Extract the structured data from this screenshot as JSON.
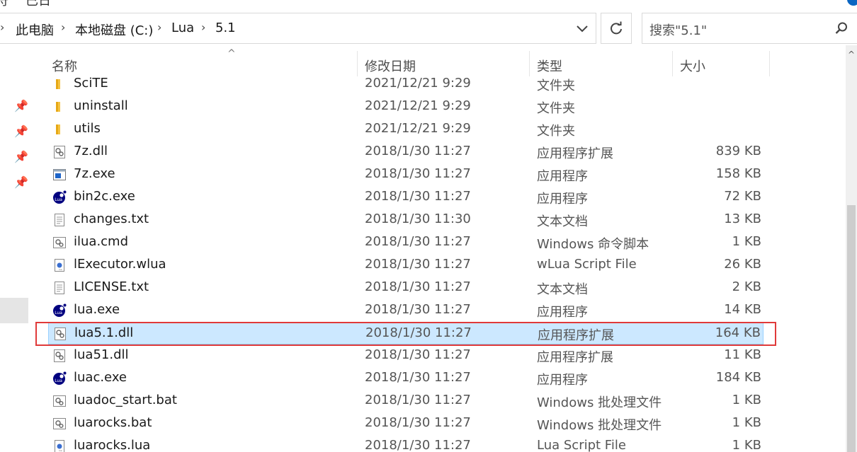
{
  "top": {
    "fragment_left": "符",
    "fragment_mid": "已日"
  },
  "address_bar": {
    "crumbs": [
      "此电脑",
      "本地磁盘 (C:)",
      "Lua",
      "5.1"
    ]
  },
  "search": {
    "placeholder": "搜索\"5.1\""
  },
  "columns": {
    "name": "名称",
    "date": "修改日期",
    "type": "类型",
    "size": "大小"
  },
  "files": [
    {
      "name": "SciTE",
      "date": "2021/12/21 9:29",
      "type": "文件夹",
      "size": "",
      "icon": "folder-icon"
    },
    {
      "name": "uninstall",
      "date": "2021/12/21 9:29",
      "type": "文件夹",
      "size": "",
      "icon": "folder-icon"
    },
    {
      "name": "utils",
      "date": "2021/12/21 9:29",
      "type": "文件夹",
      "size": "",
      "icon": "folder-icon"
    },
    {
      "name": "7z.dll",
      "date": "2018/1/30 11:27",
      "type": "应用程序扩展",
      "size": "839 KB",
      "icon": "dll-icon"
    },
    {
      "name": "7z.exe",
      "date": "2018/1/30 11:27",
      "type": "应用程序",
      "size": "158 KB",
      "icon": "exe-icon"
    },
    {
      "name": "bin2c.exe",
      "date": "2018/1/30 11:27",
      "type": "应用程序",
      "size": "72 KB",
      "icon": "lua-icon"
    },
    {
      "name": "changes.txt",
      "date": "2018/1/30 11:30",
      "type": "文本文档",
      "size": "13 KB",
      "icon": "text-file-icon"
    },
    {
      "name": "ilua.cmd",
      "date": "2018/1/30 11:27",
      "type": "Windows 命令脚本",
      "size": "1 KB",
      "icon": "script-icon"
    },
    {
      "name": "lExecutor.wlua",
      "date": "2018/1/30 11:27",
      "type": "wLua Script File",
      "size": "26 KB",
      "icon": "lua-script-icon"
    },
    {
      "name": "LICENSE.txt",
      "date": "2018/1/30 11:27",
      "type": "文本文档",
      "size": "2 KB",
      "icon": "text-file-icon"
    },
    {
      "name": "lua.exe",
      "date": "2018/1/30 11:27",
      "type": "应用程序",
      "size": "14 KB",
      "icon": "lua-icon"
    },
    {
      "name": "lua5.1.dll",
      "date": "2018/1/30 11:27",
      "type": "应用程序扩展",
      "size": "164 KB",
      "icon": "dll-icon",
      "selected": true
    },
    {
      "name": "lua51.dll",
      "date": "2018/1/30 11:27",
      "type": "应用程序扩展",
      "size": "11 KB",
      "icon": "dll-icon"
    },
    {
      "name": "luac.exe",
      "date": "2018/1/30 11:27",
      "type": "应用程序",
      "size": "184 KB",
      "icon": "lua-icon"
    },
    {
      "name": "luadoc_start.bat",
      "date": "2018/1/30 11:27",
      "type": "Windows 批处理文件",
      "size": "1 KB",
      "icon": "script-icon"
    },
    {
      "name": "luarocks.bat",
      "date": "2018/1/30 11:27",
      "type": "Windows 批处理文件",
      "size": "1 KB",
      "icon": "script-icon"
    },
    {
      "name": "luarocks.lua",
      "date": "2018/1/30 11:27",
      "type": "Lua Script File",
      "size": "1 KB",
      "icon": "lua-script-icon"
    }
  ],
  "colors": {
    "selection_bg": "#cce8ff",
    "selection_border": "#99d1ff",
    "highlight_box": "#e03a3a",
    "folder": "#f5c342",
    "lua_blue": "#00007f"
  }
}
